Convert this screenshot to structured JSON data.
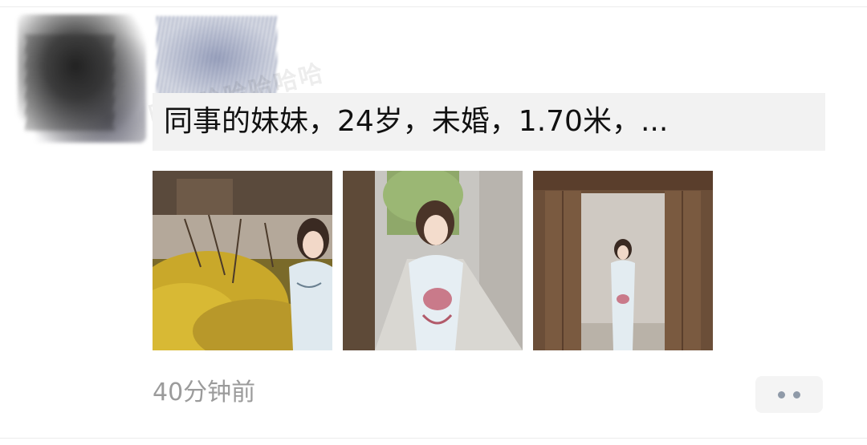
{
  "post": {
    "text": "同事的妹妹，24岁，未婚，1.70米，...",
    "watermark": "哈哈哈哈哈哈哈",
    "timestamp": "40分钟前",
    "more_icon": "more-dots-icon",
    "photos": [
      {
        "name": "photo-1",
        "scene": "woman in qipao by yellow forsythia bush"
      },
      {
        "name": "photo-2",
        "scene": "woman in qipao on alley path"
      },
      {
        "name": "photo-3",
        "scene": "woman in qipao in wooden doorway"
      }
    ]
  },
  "colors": {
    "background": "#ffffff",
    "text_bar": "#f2f2f2",
    "text": "#111111",
    "timestamp": "#9b9b9b",
    "more_button_bg": "#f4f4f4",
    "more_dots": "#8f9aa8"
  }
}
